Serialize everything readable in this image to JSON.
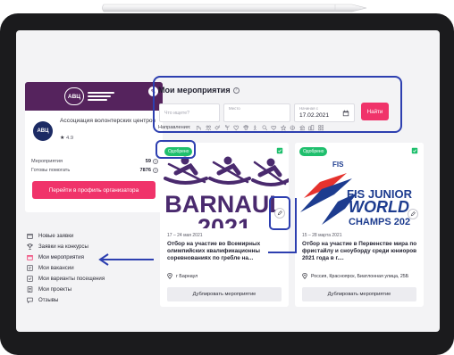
{
  "org": {
    "banner_logo": "АВЦ",
    "avatar_text": "АВЦ",
    "name": "Ассоциация волонтерских центров",
    "rating": "4.9",
    "stats": [
      {
        "label": "Мероприятия",
        "value": "59"
      },
      {
        "label": "Готовы помогать",
        "value": "7876"
      }
    ],
    "profile_button": "Перейти в профиль организатора"
  },
  "menu": [
    {
      "label": "Новые заявки",
      "icon": "calendar-icon"
    },
    {
      "label": "Заявки на конкурсы",
      "icon": "trophy-icon"
    },
    {
      "label": "Мои мероприятия",
      "icon": "calendar-icon",
      "active": true
    },
    {
      "label": "Мои вакансии",
      "icon": "vacancy-icon"
    },
    {
      "label": "Мои варианты посещения",
      "icon": "checkbox-icon"
    },
    {
      "label": "Мои проекты",
      "icon": "document-icon"
    },
    {
      "label": "Отзывы",
      "icon": "chat-icon"
    }
  ],
  "search": {
    "title": "Мои мероприятия",
    "query_placeholder": "Что ищете?",
    "place_label": "Место",
    "date_label": "Начиная с",
    "date_value": "17.02.2021",
    "find_button": "Найти",
    "directions_label": "Направления:"
  },
  "events": [
    {
      "status": "Одобрено",
      "image_text": "BARNAUL",
      "image_year": "2021",
      "date": "17 – 24 мая 2021",
      "title": "Отбор на участие во Всемирных олимпийских квалификационны соревнованиях по гребле на...",
      "location": "г Барнаул",
      "duplicate_button": "Дублировать мероприятие"
    },
    {
      "status": "Одобрено",
      "image_brand": "FIS",
      "image_line1": "FIS JUNIOR",
      "image_line2": "WORLD",
      "image_line3": "CHAMPS 202",
      "date": "15 – 28 марта 2021",
      "title": "Отбор на участие в Первенстве мира по фристайлу и сноуборду среди юниоров 2021 года в г....",
      "location": "Россия, Красноярск, Биатлонная улица, 25Б",
      "duplicate_button": "Дублировать мероприятие"
    }
  ],
  "colors": {
    "accent": "#f0336a",
    "approved": "#1fbf6d",
    "banner": "#55235d",
    "annotation": "#2d3fb0",
    "barnaul": "#4a2a6e",
    "fis_blue": "#1d3c8f",
    "fis_red": "#e5322d"
  }
}
